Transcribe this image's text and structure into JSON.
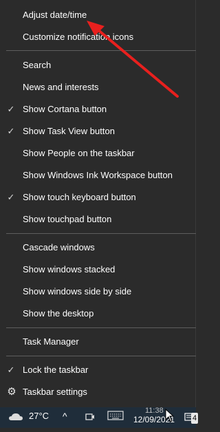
{
  "menu": {
    "items": [
      {
        "label": "Adjust date/time",
        "checked": false
      },
      {
        "label": "Customize notification icons",
        "checked": false
      },
      {
        "label": "Search",
        "checked": false
      },
      {
        "label": "News and interests",
        "checked": false
      },
      {
        "label": "Show Cortana button",
        "checked": true
      },
      {
        "label": "Show Task View button",
        "checked": true
      },
      {
        "label": "Show People on the taskbar",
        "checked": false
      },
      {
        "label": "Show Windows Ink Workspace button",
        "checked": false
      },
      {
        "label": "Show touch keyboard button",
        "checked": true
      },
      {
        "label": "Show touchpad button",
        "checked": false
      },
      {
        "label": "Cascade windows",
        "checked": false
      },
      {
        "label": "Show windows stacked",
        "checked": false
      },
      {
        "label": "Show windows side by side",
        "checked": false
      },
      {
        "label": "Show the desktop",
        "checked": false
      },
      {
        "label": "Task Manager",
        "checked": false
      },
      {
        "label": "Lock the taskbar",
        "checked": true
      },
      {
        "label": "Taskbar settings",
        "checked": false
      }
    ],
    "check_glyph": "✓",
    "settings_icon": "gear-icon"
  },
  "taskbar": {
    "weather_temp": "27°C",
    "weather_icon": "cloud-icon",
    "time": "11:38",
    "date": "12/09/2021",
    "notification_count": "4"
  },
  "annotation": {
    "color": "#e8201e"
  }
}
